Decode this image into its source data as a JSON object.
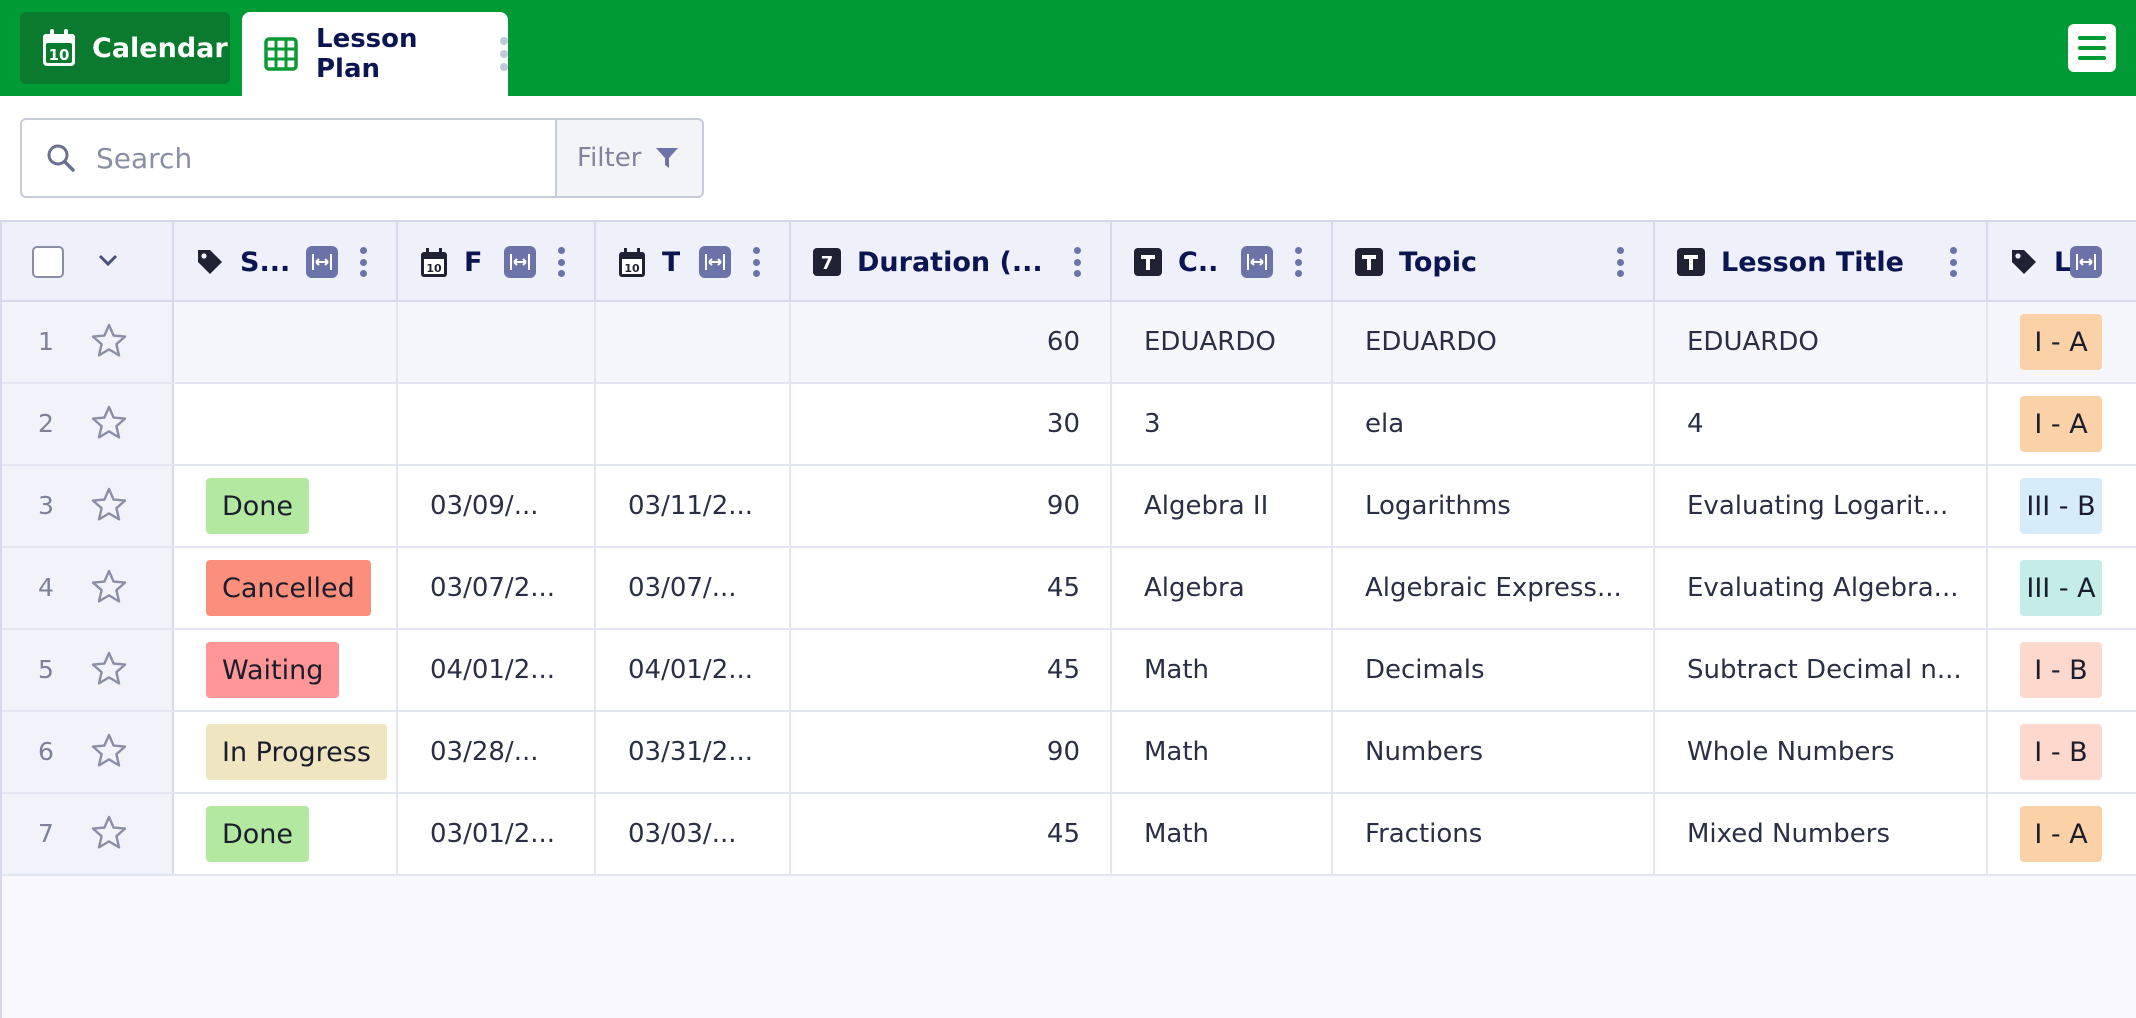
{
  "tabs": [
    {
      "label": "Calendar",
      "icon": "calendar-icon",
      "active": false
    },
    {
      "label": "Lesson Plan",
      "icon": "grid-table-icon",
      "active": true
    }
  ],
  "calendar_icon_day": "10",
  "search": {
    "placeholder": "Search",
    "value": ""
  },
  "filter": {
    "label": "Filter"
  },
  "colors": {
    "brand": "#009b34",
    "header_bg": "#eef0fa",
    "accent": "#6c73a8"
  },
  "columns": [
    {
      "label": "S...",
      "type_icon": "tag-icon"
    },
    {
      "label": "F",
      "type_icon": "date-icon"
    },
    {
      "label": "T",
      "type_icon": "date-icon"
    },
    {
      "label": "Duration (...",
      "type_icon": "number-icon"
    },
    {
      "label": "C..",
      "type_icon": "text-icon"
    },
    {
      "label": "Topic",
      "type_icon": "text-icon"
    },
    {
      "label": "Lesson Title",
      "type_icon": "text-icon"
    },
    {
      "label": "L",
      "type_icon": "tag-icon"
    }
  ],
  "rows": [
    {
      "n": "1",
      "status": "",
      "status_color": "",
      "from": "",
      "to": "",
      "duration": "60",
      "course": "EDUARDO",
      "topic": "EDUARDO",
      "title": "EDUARDO",
      "level": "I - A",
      "level_color": "#fbd2a8"
    },
    {
      "n": "2",
      "status": "",
      "status_color": "",
      "from": "",
      "to": "",
      "duration": "30",
      "course": "3",
      "topic": "ela",
      "title": "4",
      "level": "I - A",
      "level_color": "#fbd2a8"
    },
    {
      "n": "3",
      "status": "Done",
      "status_color": "#b2e8a0",
      "from": "03/09/...",
      "to": "03/11/2...",
      "duration": "90",
      "course": "Algebra II",
      "topic": "Logarithms",
      "title": "Evaluating Logarit...",
      "level": "III - B",
      "level_color": "#d6ecfb"
    },
    {
      "n": "4",
      "status": "Cancelled",
      "status_color": "#fb8f7c",
      "from": "03/07/2...",
      "to": "03/07/...",
      "duration": "45",
      "course": "Algebra",
      "topic": "Algebraic Express...",
      "title": "Evaluating Algebra...",
      "level": "III - A",
      "level_color": "#c3ede6"
    },
    {
      "n": "5",
      "status": "Waiting",
      "status_color": "#fe9596",
      "from": "04/01/2...",
      "to": "04/01/2...",
      "duration": "45",
      "course": "Math",
      "topic": "Decimals",
      "title": "Subtract Decimal n...",
      "level": "I - B",
      "level_color": "#fdd8cd"
    },
    {
      "n": "6",
      "status": "In Progress",
      "status_color": "#efe6c1",
      "from": "03/28/...",
      "to": "03/31/2...",
      "duration": "90",
      "course": "Math",
      "topic": "Numbers",
      "title": "Whole Numbers",
      "level": "I - B",
      "level_color": "#fdd8cd"
    },
    {
      "n": "7",
      "status": "Done",
      "status_color": "#b2e8a0",
      "from": "03/01/2...",
      "to": "03/03/...",
      "duration": "45",
      "course": "Math",
      "topic": "Fractions",
      "title": "Mixed Numbers",
      "level": "I - A",
      "level_color": "#fbd2a8"
    }
  ]
}
